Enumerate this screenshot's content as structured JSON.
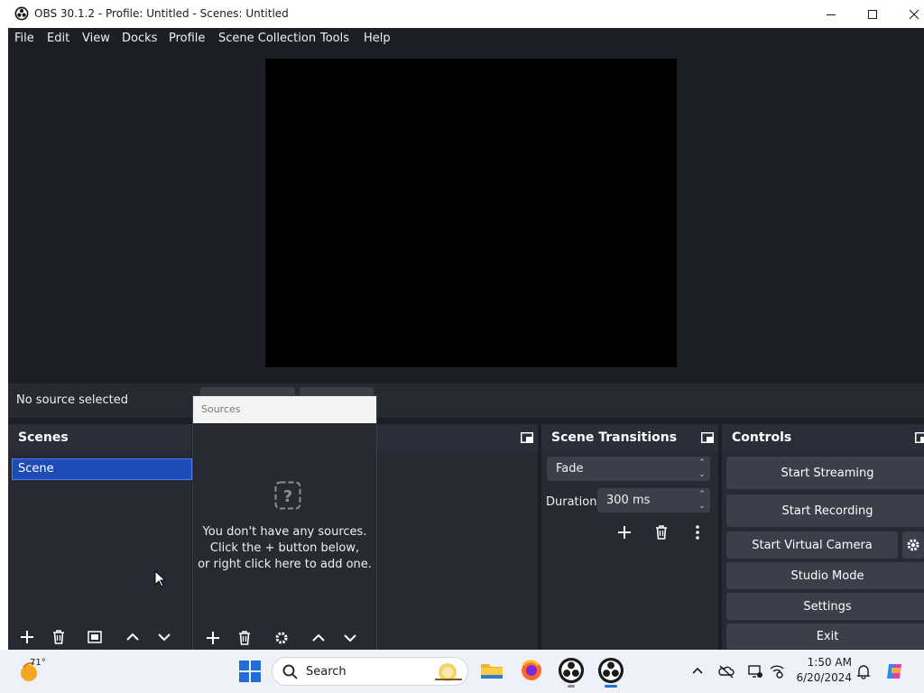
{
  "window": {
    "title": "OBS 30.1.2 - Profile: Untitled - Scenes: Untitled"
  },
  "menu": [
    "File",
    "Edit",
    "View",
    "Docks",
    "Profile",
    "Scene Collection",
    "Tools",
    "Help"
  ],
  "status": {
    "no_source": "No source selected"
  },
  "scenes_dock": {
    "title": "Scenes",
    "items": [
      "Scene"
    ]
  },
  "sources_dock": {
    "title": "Sources",
    "empty_lines": [
      "You don't have any sources.",
      "Click the + button below,",
      "or right click here to add one."
    ]
  },
  "transitions_dock": {
    "title": "Scene Transitions",
    "transition": "Fade",
    "duration_label": "Duration",
    "duration_value": "300 ms"
  },
  "controls_dock": {
    "title": "Controls",
    "buttons": [
      "Start Streaming",
      "Start Recording",
      "Start Virtual Camera",
      "Studio Mode",
      "Settings",
      "Exit"
    ]
  },
  "taskbar": {
    "weather_temp": "71°",
    "search_label": "Search",
    "time": "1:50 AM",
    "date": "6/20/2024"
  },
  "colors": {
    "window_bg": "#1d1f26",
    "dock_bg": "#272a33",
    "button_bg": "#3b3f4a",
    "selection": "#1d4cb7"
  }
}
